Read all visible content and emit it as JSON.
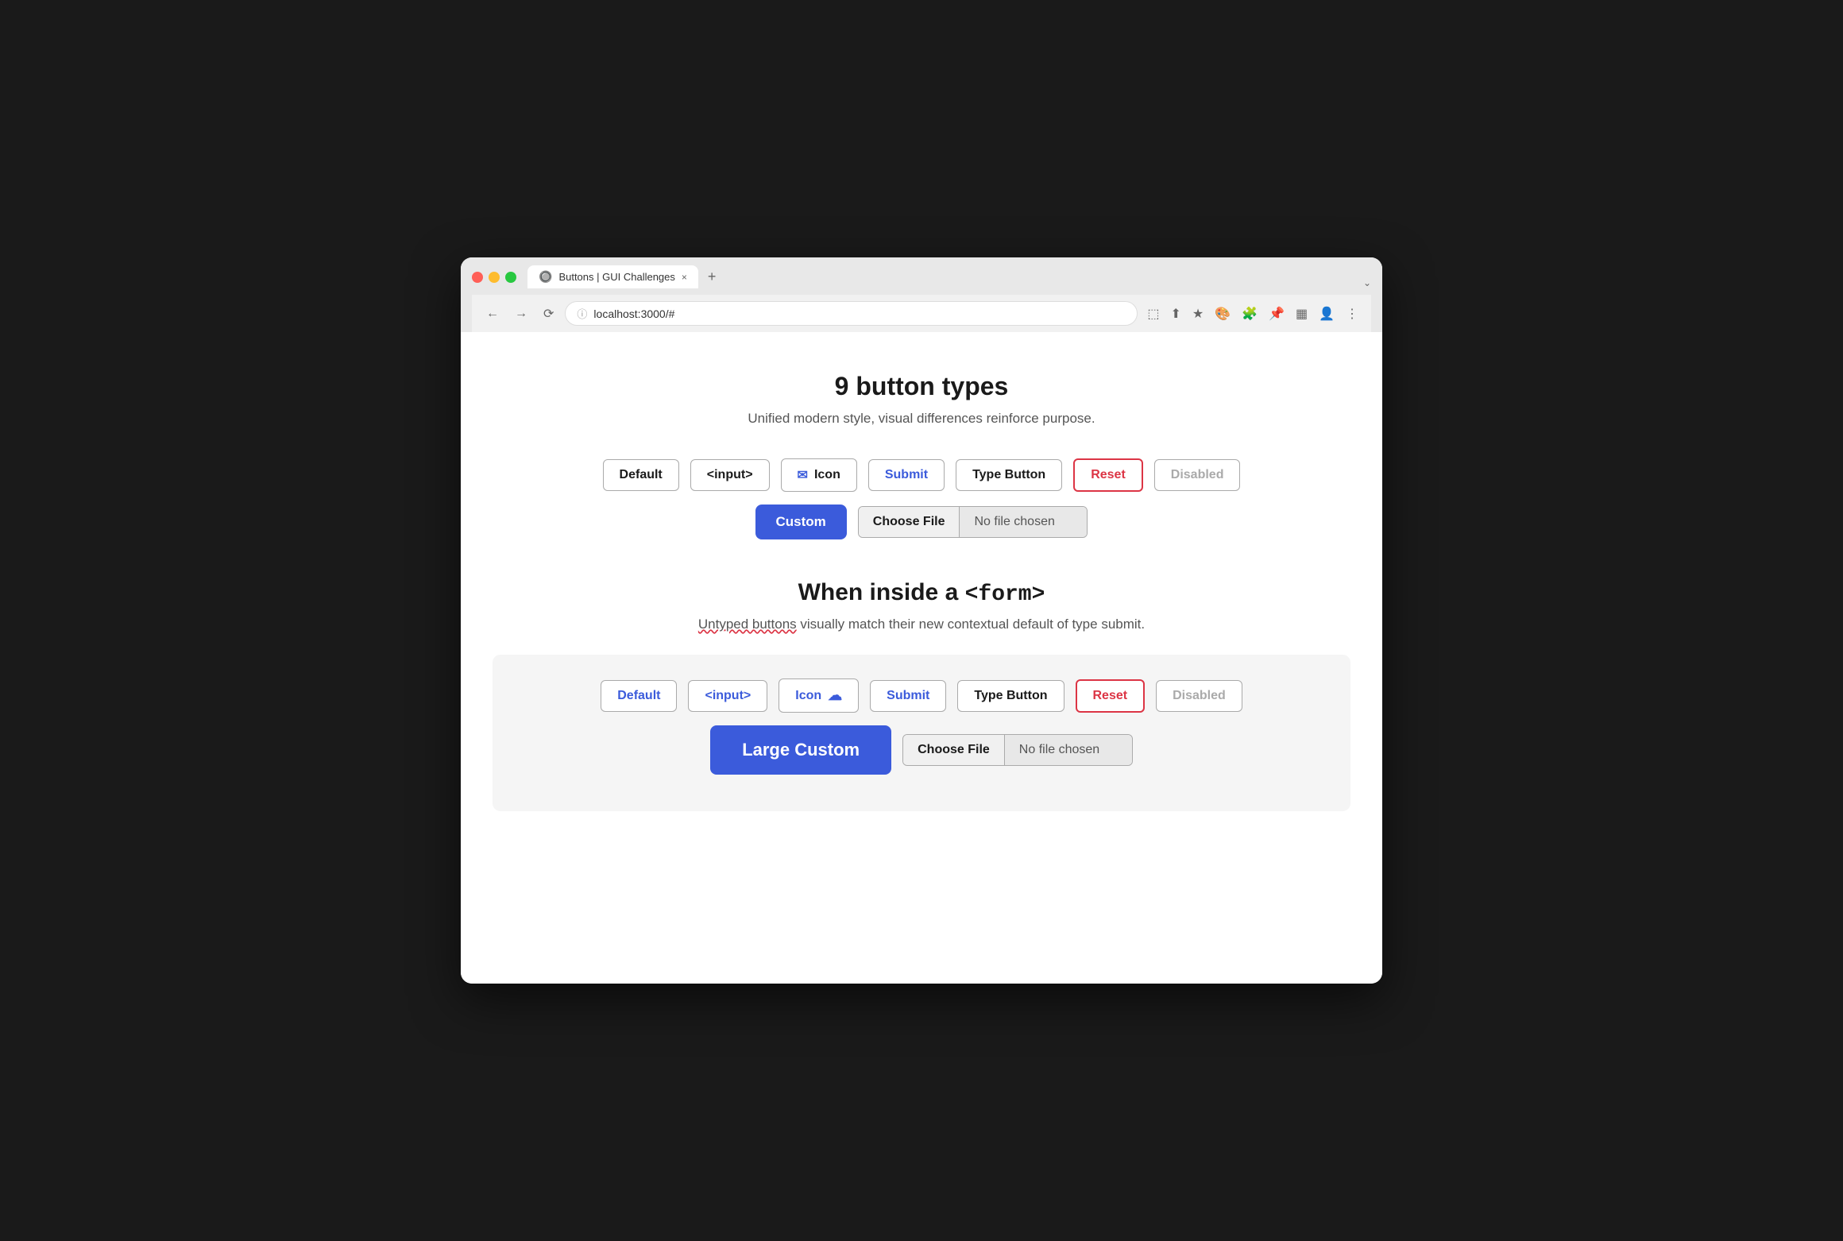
{
  "browser": {
    "tab_favicon": "🔘",
    "tab_title": "Buttons | GUI Challenges",
    "tab_close": "×",
    "tab_new": "+",
    "tab_dropdown": "⌄",
    "address": "localhost:3000/#",
    "address_icon": "ⓘ"
  },
  "page": {
    "main_title": "9 button types",
    "main_subtitle": "Unified modern style, visual differences reinforce purpose.",
    "buttons_row1": [
      {
        "label": "Default",
        "type": "default"
      },
      {
        "label": "<input>",
        "type": "default"
      },
      {
        "label": "Icon",
        "type": "icon"
      },
      {
        "label": "Submit",
        "type": "submit"
      },
      {
        "label": "Type Button",
        "type": "type-button"
      },
      {
        "label": "Reset",
        "type": "reset"
      },
      {
        "label": "Disabled",
        "type": "disabled"
      }
    ],
    "custom_label": "Custom",
    "file_choose_label": "Choose File",
    "file_no_chosen_label": "No file chosen",
    "form_section_title": "When inside a ",
    "form_section_tag": "<form>",
    "form_subtitle_before": "Untyped buttons",
    "form_subtitle_after": " visually match their new contextual default of type submit.",
    "form_buttons_row1": [
      {
        "label": "Default",
        "type": "default-form"
      },
      {
        "label": "<input>",
        "type": "default-form"
      },
      {
        "label": "Icon",
        "type": "icon-form"
      },
      {
        "label": "Submit",
        "type": "submit-form"
      },
      {
        "label": "Type Button",
        "type": "type-button"
      },
      {
        "label": "Reset",
        "type": "reset"
      },
      {
        "label": "Disabled",
        "type": "disabled"
      }
    ],
    "large_custom_label": "Large Custom",
    "form_file_choose_label": "Choose File",
    "form_file_no_chosen_label": "No file chosen"
  }
}
